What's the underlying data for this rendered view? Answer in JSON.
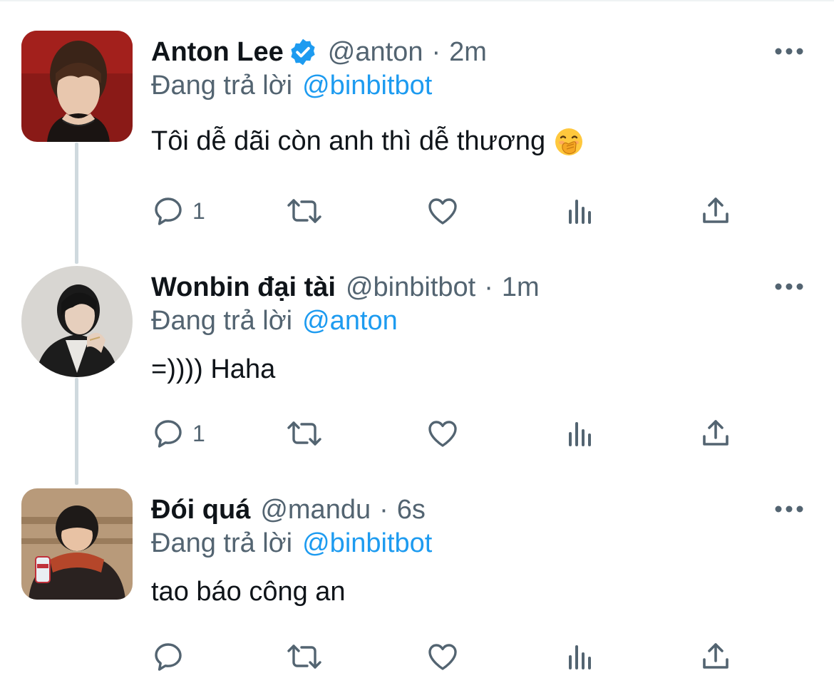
{
  "colors": {
    "accent": "#1d9bf0",
    "secondary_text": "#536471",
    "primary_text": "#0f1419",
    "thread_line": "#cfd9de"
  },
  "tweets": [
    {
      "display_name": "Anton Lee",
      "verified": true,
      "handle": "@anton",
      "separator": "·",
      "time": "2m",
      "reply_prefix": "Đang trả lời",
      "reply_to": "@binbitbot",
      "text": "Tôi dễ dãi còn anh thì dễ thương",
      "emoji": "face-with-hand-over-mouth",
      "reply_count": "1",
      "avatar_shape": "rounded",
      "actions": [
        "reply-icon",
        "retweet-icon",
        "like-icon",
        "views-icon",
        "share-icon"
      ]
    },
    {
      "display_name": "Wonbin đại tài",
      "verified": false,
      "handle": "@binbitbot",
      "separator": "·",
      "time": "1m",
      "reply_prefix": "Đang trả lời",
      "reply_to": "@anton",
      "text": "=)))) Haha",
      "reply_count": "1",
      "avatar_shape": "circle",
      "actions": [
        "reply-icon",
        "retweet-icon",
        "like-icon",
        "views-icon",
        "share-icon"
      ]
    },
    {
      "display_name": "Đói quá",
      "verified": false,
      "handle": "@mandu",
      "separator": "·",
      "time": "6s",
      "reply_prefix": "Đang trả lời",
      "reply_to": "@binbitbot",
      "text": "tao báo công an",
      "reply_count": "",
      "avatar_shape": "rounded",
      "actions": [
        "reply-icon",
        "retweet-icon",
        "like-icon",
        "views-icon",
        "share-icon"
      ]
    }
  ]
}
